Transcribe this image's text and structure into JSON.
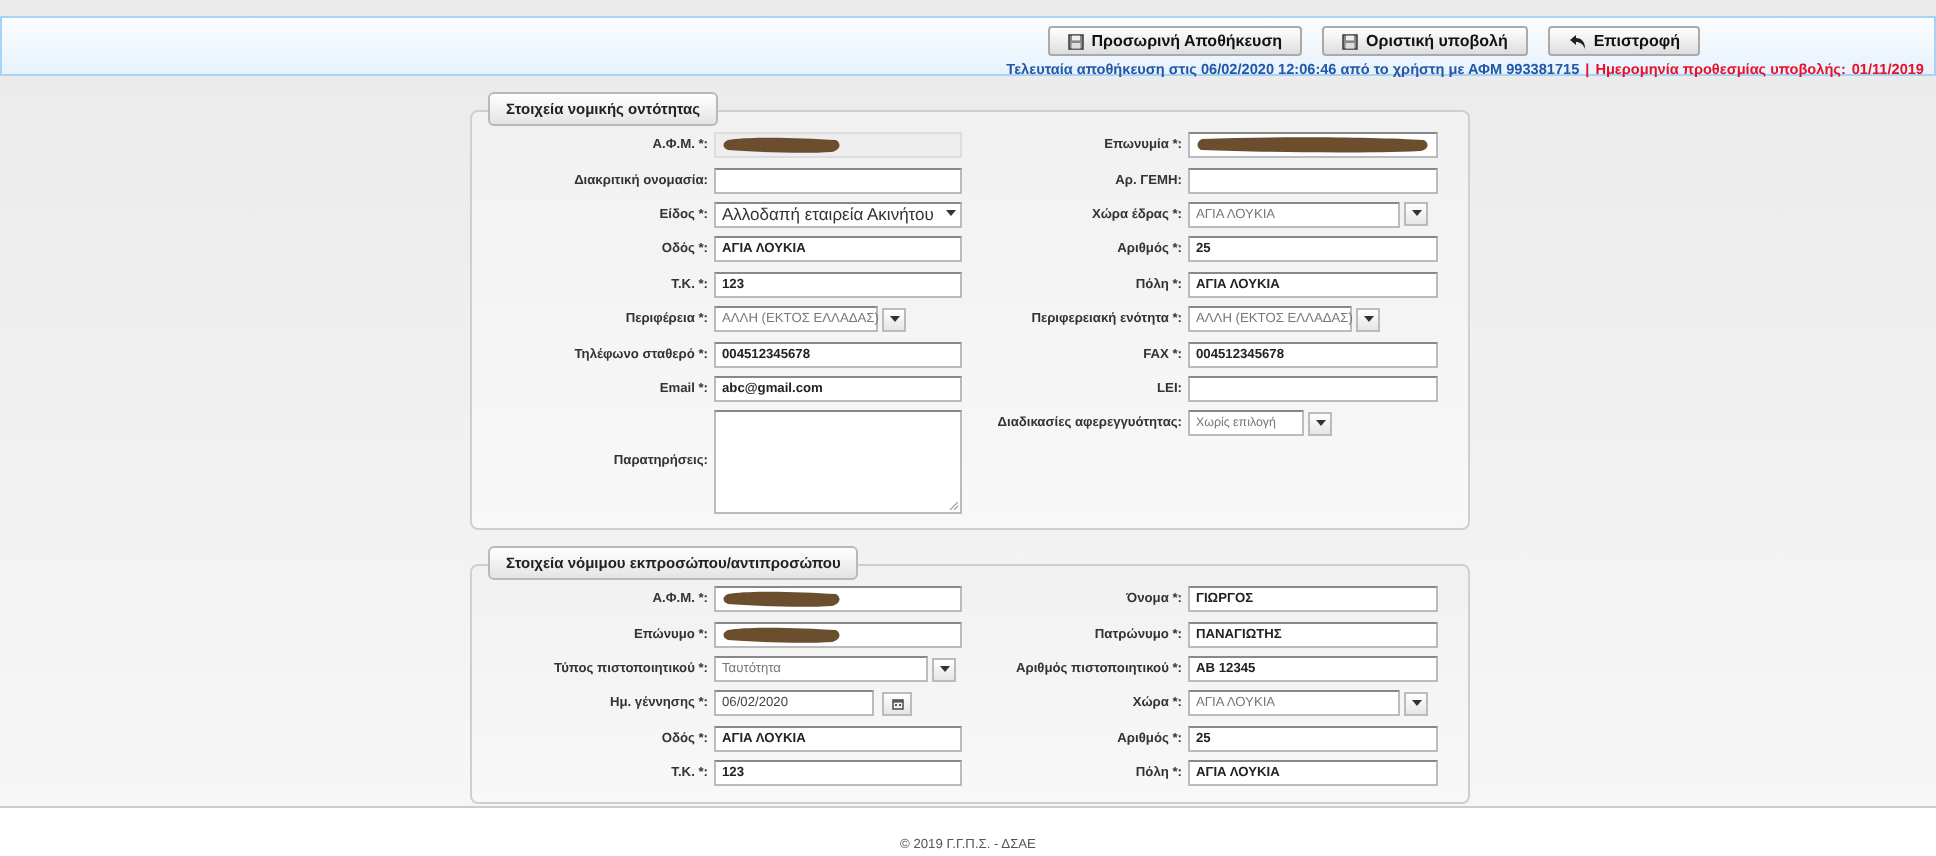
{
  "toolbar": {
    "buttons": [
      {
        "kind": "save",
        "label": "Προσωρινή Αποθήκευση"
      },
      {
        "kind": "save",
        "label": "Οριστική υποβολή"
      },
      {
        "kind": "back",
        "label": "Επιστροφή"
      }
    ],
    "status": {
      "last_saved": "Τελευταία αποθήκευση στις 06/02/2020 12:06:46 από το χρήστη με ΑΦΜ 993381715",
      "separator": "|",
      "deadline_label": "Ημερομηνία προθεσμίας υποβολής:",
      "deadline": "01/11/2019"
    }
  },
  "sections": [
    {
      "legend": "Στοιχεία νομικής οντότητας",
      "rows": [
        {
          "left": {
            "label": "Α.Φ.Μ. *:",
            "kind": "redacted",
            "disabled": true
          },
          "right": {
            "label": "Επωνυμία *:",
            "kind": "redacted",
            "disabled": false
          }
        },
        {
          "left": {
            "label": "Διακριτική ονομασία:",
            "kind": "text",
            "disabled": false
          },
          "right": {
            "label": "Αρ. ΓΕΜΗ:",
            "kind": "text",
            "disabled": false
          }
        },
        {
          "left": {
            "label": "Είδος *:",
            "kind": "dropdown",
            "value": "Αλλοδαπή εταιρεία Ακινήτου",
            "disabled": false
          },
          "right": {
            "label": "Χώρα έδρας *:",
            "kind": "select",
            "value": "ΑΓΙΑ ΛΟΥΚΙΑ",
            "disabled": false
          }
        },
        {
          "left": {
            "label": "Οδός *:",
            "kind": "text",
            "value": "ΑΓΙΑ ΛΟΥΚΙΑ",
            "disabled": false
          },
          "right": {
            "label": "Αριθμός *:",
            "kind": "text",
            "value": "25",
            "disabled": false
          }
        },
        {
          "left": {
            "label": "Τ.Κ. *:",
            "kind": "text",
            "value": "123",
            "disabled": false
          },
          "right": {
            "label": "Πόλη *:",
            "kind": "text",
            "value": "ΑΓΙΑ ΛΟΥΚΙΑ",
            "disabled": false
          }
        },
        {
          "left": {
            "label": "Περιφέρεια *:",
            "kind": "select-short",
            "value": "ΑΛΛΗ (ΕΚΤΟΣ ΕΛΛΑΔΑΣ)",
            "disabled": false
          },
          "right": {
            "label": "Περιφερειακή ενότητα *:",
            "kind": "select-short",
            "value": "ΑΛΛΗ (ΕΚΤΟΣ ΕΛΛΑΔΑΣ)",
            "disabled": false
          }
        },
        {
          "left": {
            "label": "Τηλέφωνο σταθερό *:",
            "kind": "text",
            "value": "004512345678",
            "disabled": false
          },
          "right": {
            "label": "FAX *:",
            "kind": "text",
            "value": "004512345678",
            "disabled": false
          }
        },
        {
          "left": {
            "label": "Email *:",
            "kind": "text",
            "value": "abc@gmail.com",
            "disabled": false
          },
          "right": {
            "label": "LEI:",
            "kind": "text",
            "disabled": false
          }
        },
        {
          "left": {
            "label": "Παρατηρήσεις:",
            "kind": "textarea",
            "disabled": false
          },
          "right": {
            "label": "Διαδικασίες αφερεγγυότητας:",
            "kind": "select-tiny",
            "value": "Χωρίς επιλογή",
            "disabled": false
          }
        }
      ]
    },
    {
      "legend": "Στοιχεία νόμιμου εκπροσώπου/αντιπροσώπου",
      "rows": [
        {
          "left": {
            "label": "Α.Φ.Μ. *:",
            "kind": "redacted",
            "disabled": false
          },
          "right": {
            "label": "Όνομα *:",
            "kind": "text",
            "value": "ΓΙΩΡΓΟΣ",
            "disabled": false
          }
        },
        {
          "left": {
            "label": "Επώνυμο *:",
            "kind": "redacted",
            "disabled": false
          },
          "right": {
            "label": "Πατρώνυμο *:",
            "kind": "text",
            "value": "ΠΑΝΑΓΙΩΤΗΣ",
            "disabled": false
          }
        },
        {
          "left": {
            "label": "Τύπος πιστοποιητικού *:",
            "kind": "select",
            "value": "Ταυτότητα",
            "disabled": false
          },
          "right": {
            "label": "Αριθμός πιστοποιητικού *:",
            "kind": "text",
            "value": "ΑΒ 12345",
            "disabled": false
          }
        },
        {
          "left": {
            "label": "Ημ. γέννησης *:",
            "kind": "date",
            "value": "06/02/2020",
            "disabled": false
          },
          "right": {
            "label": "Χώρα *:",
            "kind": "select",
            "value": "ΑΓΙΑ ΛΟΥΚΙΑ",
            "disabled": false
          }
        },
        {
          "left": {
            "label": "Οδός *:",
            "kind": "text",
            "value": "ΑΓΙΑ ΛΟΥΚΙΑ",
            "disabled": false
          },
          "right": {
            "label": "Αριθμός *:",
            "kind": "text",
            "value": "25",
            "disabled": false
          }
        },
        {
          "left": {
            "label": "Τ.Κ. *:",
            "kind": "text",
            "value": "123",
            "disabled": false
          },
          "right": {
            "label": "Πόλη *:",
            "kind": "text",
            "value": "ΑΓΙΑ ΛΟΥΚΙΑ",
            "disabled": false
          }
        }
      ]
    }
  ],
  "footer": {
    "text": "© 2019 Γ.Γ.Π.Σ. - ΔΣΑΕ"
  }
}
